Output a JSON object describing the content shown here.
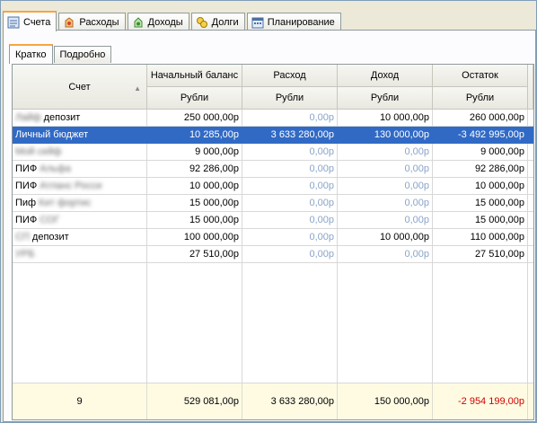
{
  "tabs": [
    {
      "label": "Счета",
      "icon": "accounts-icon",
      "active": true
    },
    {
      "label": "Расходы",
      "icon": "expenses-icon",
      "active": false
    },
    {
      "label": "Доходы",
      "icon": "income-icon",
      "active": false
    },
    {
      "label": "Долги",
      "icon": "debts-icon",
      "active": false
    },
    {
      "label": "Планирование",
      "icon": "planning-icon",
      "active": false
    }
  ],
  "subtabs": [
    {
      "label": "Кратко",
      "active": true
    },
    {
      "label": "Подробно",
      "active": false
    }
  ],
  "columns": {
    "account": "Счет",
    "opening": "Начальный баланс",
    "expense": "Расход",
    "income": "Доход",
    "balance": "Остаток",
    "currency": "Рубли"
  },
  "rows": [
    {
      "prefix": "",
      "hidden": "Лайф",
      "suffix": " депозит",
      "opening": "250 000,00р",
      "expense": "0,00р",
      "income": "10 000,00р",
      "balance": "260 000,00р",
      "selected": false
    },
    {
      "prefix": "Личный бюджет",
      "hidden": "",
      "suffix": "",
      "opening": "10 285,00р",
      "expense": "3 633 280,00р",
      "income": "130 000,00р",
      "balance": "-3 492 995,00р",
      "selected": true
    },
    {
      "prefix": "",
      "hidden": "Мой сейф",
      "suffix": "",
      "opening": "9 000,00р",
      "expense": "0,00р",
      "income": "0,00р",
      "balance": "9 000,00р",
      "selected": false
    },
    {
      "prefix": "ПИФ ",
      "hidden": "Альфа",
      "suffix": "",
      "opening": "92 286,00р",
      "expense": "0,00р",
      "income": "0,00р",
      "balance": "92 286,00р",
      "selected": false
    },
    {
      "prefix": "ПИФ ",
      "hidden": "Атланс Росси",
      "suffix": "",
      "opening": "10 000,00р",
      "expense": "0,00р",
      "income": "0,00р",
      "balance": "10 000,00р",
      "selected": false
    },
    {
      "prefix": "Пиф ",
      "hidden": "Кит фортис",
      "suffix": "",
      "opening": "15 000,00р",
      "expense": "0,00р",
      "income": "0,00р",
      "balance": "15 000,00р",
      "selected": false
    },
    {
      "prefix": "ПИФ ",
      "hidden": "СОГ",
      "suffix": "",
      "opening": "15 000,00р",
      "expense": "0,00р",
      "income": "0,00р",
      "balance": "15 000,00р",
      "selected": false
    },
    {
      "prefix": "",
      "hidden": "СП",
      "suffix": " депозит",
      "opening": "100 000,00р",
      "expense": "0,00р",
      "income": "10 000,00р",
      "balance": "110 000,00р",
      "selected": false
    },
    {
      "prefix": "",
      "hidden": "УРБ",
      "suffix": "",
      "opening": "27 510,00р",
      "expense": "0,00р",
      "income": "0,00р",
      "balance": "27 510,00р",
      "selected": false
    }
  ],
  "totals": {
    "count": "9",
    "opening": "529 081,00р",
    "expense": "3 633 280,00р",
    "income": "150 000,00р",
    "balance": "-2 954 199,00р"
  },
  "colors": {
    "selection": "#316ac5",
    "zero_value": "#8aa4c8",
    "negative": "#d40000",
    "totals_bg": "#fffbe3",
    "tab_accent": "#f7a541"
  }
}
